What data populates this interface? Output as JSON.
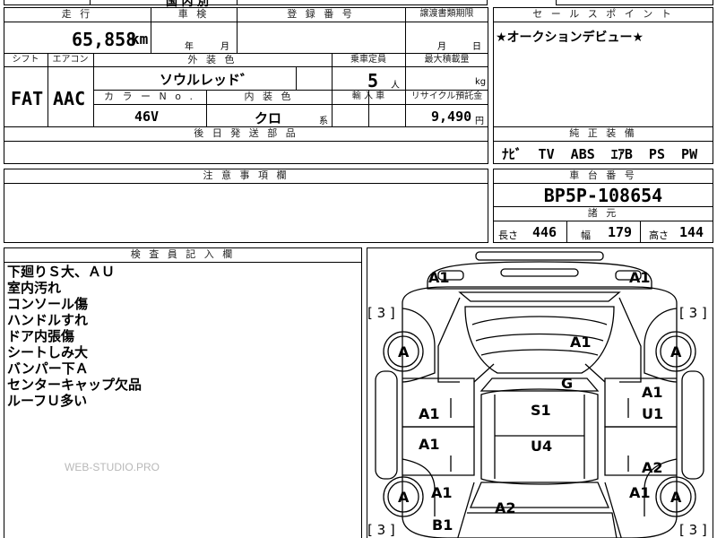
{
  "top_row": {
    "cut_text": "国 内 別"
  },
  "mileage": {
    "header": "走 行",
    "value": "65,858",
    "unit": "km"
  },
  "inspection": {
    "header": "車 検",
    "year_unit": "年",
    "month_unit": "月"
  },
  "registration": {
    "header": "登 録 番 号"
  },
  "transfer": {
    "header": "譲渡書類期限",
    "month_unit": "月",
    "day_unit": "日"
  },
  "sales_points": {
    "header": "セ ー ル ス ポ イ ン ト",
    "text": "★オークションデビュー★"
  },
  "shift": {
    "header": "シフト",
    "value": "FAT"
  },
  "aircon": {
    "header": "エアコン",
    "value": "AAC"
  },
  "exterior": {
    "header": "外 装 色",
    "value": "ソウルレッド゛"
  },
  "capacity": {
    "header": "乗車定員",
    "value": "5",
    "unit": "人"
  },
  "max_load": {
    "header": "最大積載量",
    "unit": "kg"
  },
  "color_no": {
    "header": "カ ラ ー N o .",
    "value": "46V"
  },
  "interior": {
    "header": "内 装 色",
    "value": "クロ",
    "unit": "系"
  },
  "import": {
    "header": "輸 入 車"
  },
  "recycle": {
    "header": "リサイクル預託金",
    "value": "9,490",
    "unit": "円"
  },
  "later_parts": {
    "header": "後 日 発 送 部 品"
  },
  "equipment": {
    "header": "純 正 装 備",
    "value": "ﾅﾋﾞ  TV  ABS  ｴｱB  PS  PW"
  },
  "caution": {
    "header": "注 意 事 項 欄"
  },
  "chassis": {
    "header": "車 台 番 号",
    "value": "BP5P-108654"
  },
  "specs": {
    "header": "諸 元",
    "length_label": "長さ",
    "length_value": "446",
    "width_label": "幅",
    "width_value": "179",
    "height_label": "高さ",
    "height_value": "144"
  },
  "inspector": {
    "header": "検 査 員 記 入 欄",
    "lines": [
      "下廻りＳ大、ＡＵ",
      "室内汚れ",
      "コンソール傷",
      "ハンドルすれ",
      "ドア内張傷",
      "シートしみ大",
      "バンパー下Ａ",
      "センターキャップ欠品",
      "ルーフＵ多い"
    ]
  },
  "watermark": "WEB-STUDIO.PRO",
  "diagram": {
    "labels": {
      "front_left": "A1",
      "front_right": "A1",
      "tire_count_tl": "[ 3 ]",
      "tire_count_tr": "[ 3 ]",
      "tire_count_bl": "[ 3 ]",
      "tire_count_br": "[ 3 ]",
      "wheel_fl": "A",
      "wheel_fr": "A",
      "wheel_rl": "A",
      "wheel_rr": "A",
      "hood": "A1",
      "windshield": "G",
      "fender_right": "A1",
      "door_front_left": "A1",
      "roof_front": "S1",
      "door_front_right": "U1",
      "door_rear_left": "A1",
      "roof_rear": "U4",
      "door_rear_right": "A2",
      "quarter_left": "A1",
      "quarter_right": "A1",
      "trunk": "A2",
      "rear_bumper_left": "B1"
    }
  }
}
